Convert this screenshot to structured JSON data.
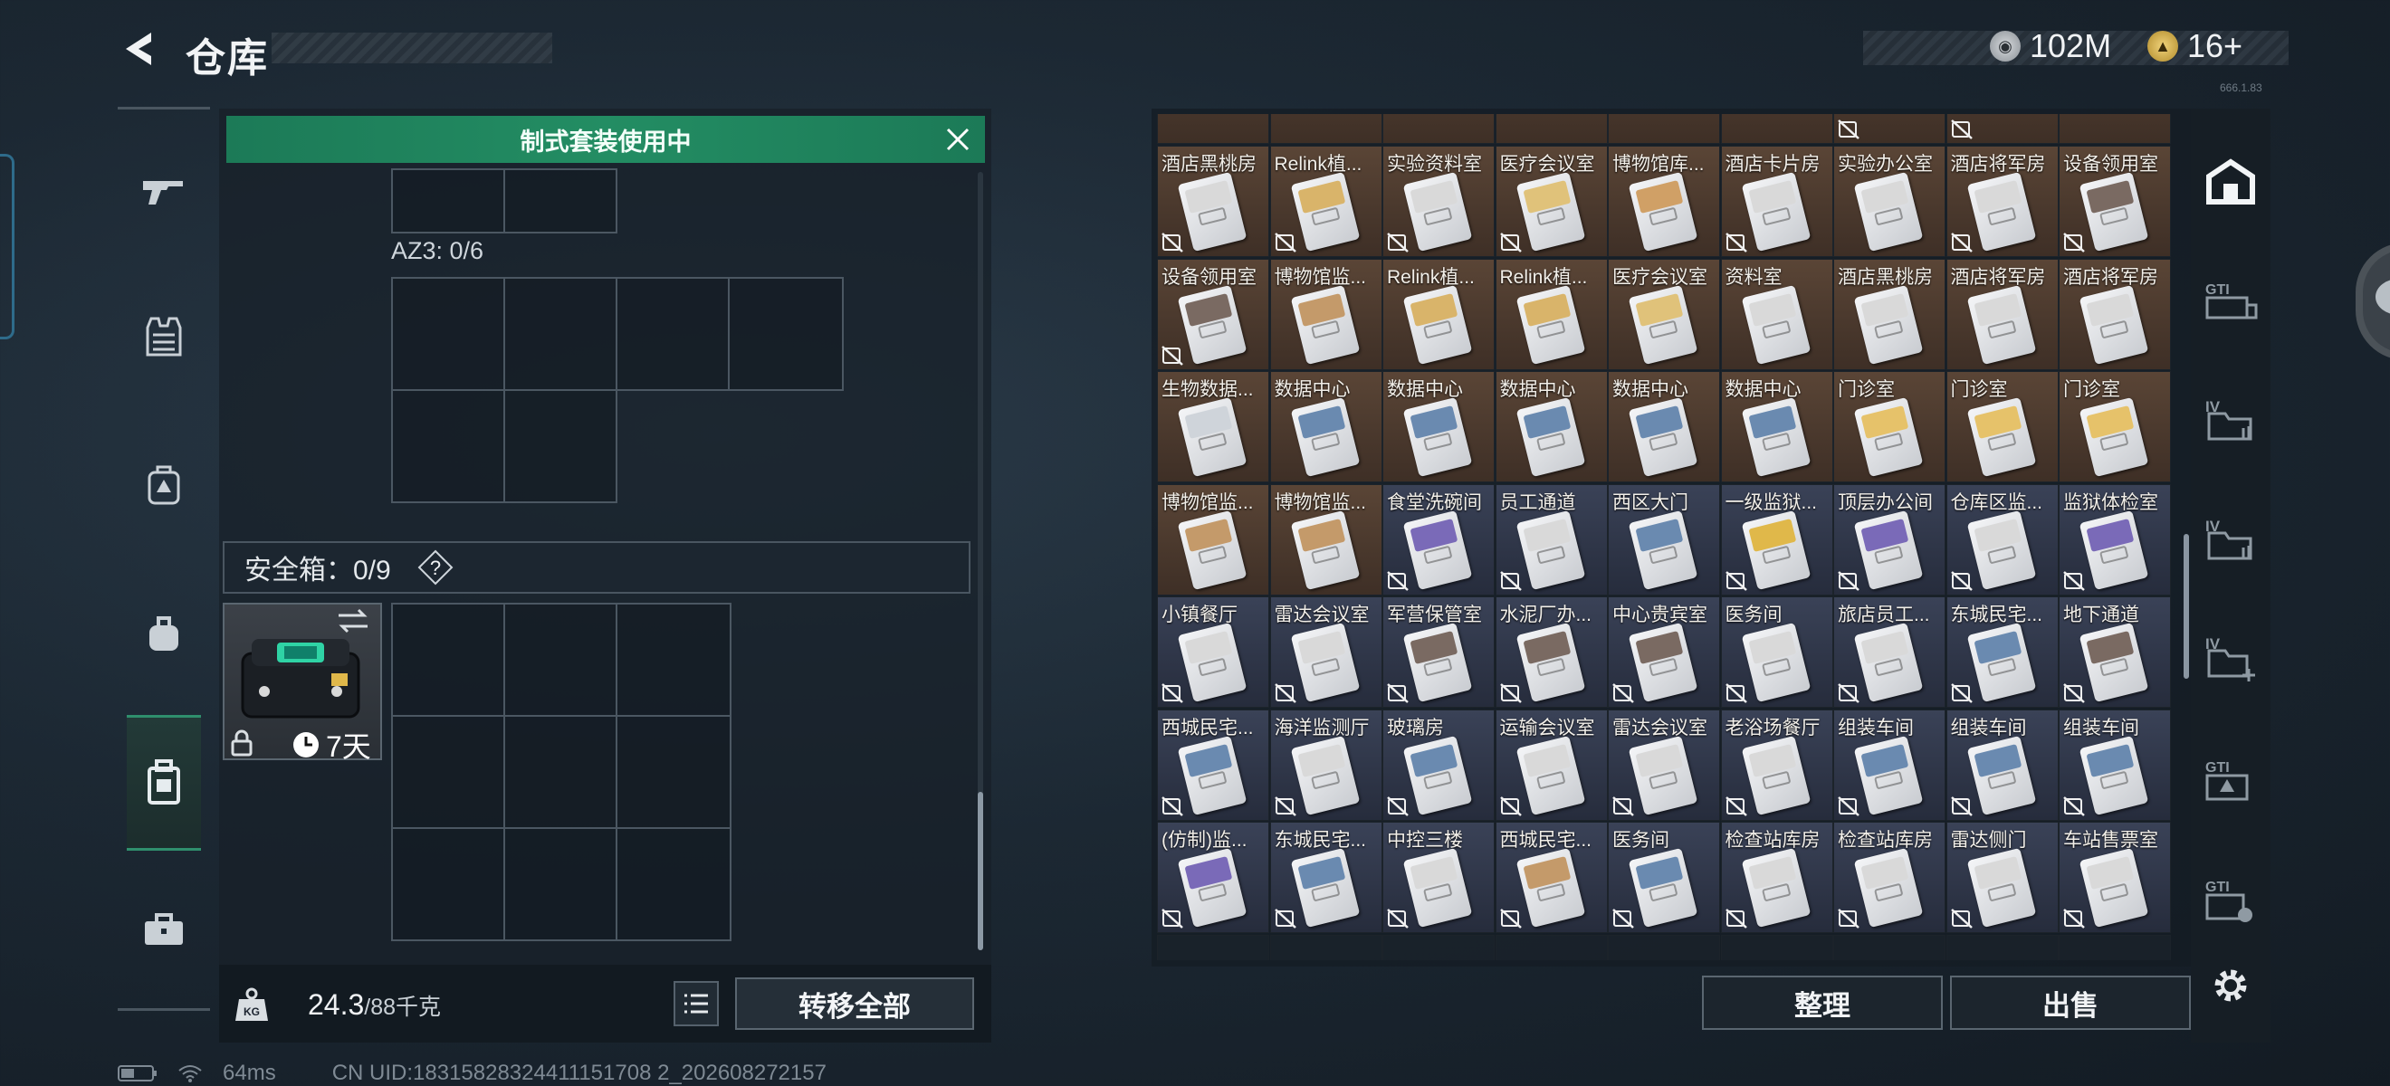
{
  "header": {
    "title": "仓库",
    "currency1": "102M",
    "currency2": "16+",
    "version": "666.1.83"
  },
  "banner": {
    "text": "制式套装使用中"
  },
  "vest": {
    "label": "AZ3: 0/6"
  },
  "safe": {
    "label": "安全箱：0/9",
    "days": "7天"
  },
  "footer": {
    "weight": "24.3",
    "capacity": "/88千克",
    "transfer": "转移全部"
  },
  "actions": {
    "sort": "整理",
    "sell": "出售"
  },
  "status": {
    "ping": "64ms",
    "uid": "CN UID:18315828324411151708 2_202608272157"
  },
  "grid": {
    "items": [
      {
        "name": "酒店黑桃房",
        "bg": "brown",
        "band": "#d9d9d9",
        "nosell": true
      },
      {
        "name": "Relink植...",
        "bg": "brown",
        "band": "#d9b46a",
        "nosell": true
      },
      {
        "name": "实验资料室",
        "bg": "brown",
        "band": "#d9d9d9",
        "nosell": true
      },
      {
        "name": "医疗会议室",
        "bg": "brown",
        "band": "#e0c27a",
        "nosell": true
      },
      {
        "name": "博物馆库...",
        "bg": "brown",
        "band": "#d0a066",
        "nosell": false
      },
      {
        "name": "酒店卡片房",
        "bg": "brown",
        "band": "#d9d9d9",
        "nosell": true
      },
      {
        "name": "实验办公室",
        "bg": "brown",
        "band": "#d9d9d9",
        "nosell": false
      },
      {
        "name": "酒店将军房",
        "bg": "brown",
        "band": "#d9d9d9",
        "nosell": true
      },
      {
        "name": "设备领用室",
        "bg": "brown",
        "band": "#7a6a62",
        "nosell": true
      },
      {
        "name": "设备领用室",
        "bg": "brown",
        "band": "#7a6a62",
        "nosell": true
      },
      {
        "name": "博物馆监...",
        "bg": "brown",
        "band": "#c49a6a",
        "nosell": false
      },
      {
        "name": "Relink植...",
        "bg": "brown",
        "band": "#d9b46a",
        "nosell": false
      },
      {
        "name": "Relink植...",
        "bg": "brown",
        "band": "#d9b46a",
        "nosell": false
      },
      {
        "name": "医疗会议室",
        "bg": "brown",
        "band": "#e0c27a",
        "nosell": false
      },
      {
        "name": "资料室",
        "bg": "brown",
        "band": "#d9d9d9",
        "nosell": false
      },
      {
        "name": "酒店黑桃房",
        "bg": "brown",
        "band": "#d9d9d9",
        "nosell": false
      },
      {
        "name": "酒店将军房",
        "bg": "brown",
        "band": "#d9d9d9",
        "nosell": false
      },
      {
        "name": "酒店将军房",
        "bg": "brown",
        "band": "#d9d9d9",
        "nosell": false
      },
      {
        "name": "生物数据...",
        "bg": "brown",
        "band": "#cfd4da",
        "nosell": false
      },
      {
        "name": "数据中心",
        "bg": "brown",
        "band": "#6a8ab0",
        "nosell": false
      },
      {
        "name": "数据中心",
        "bg": "brown",
        "band": "#6a8ab0",
        "nosell": false
      },
      {
        "name": "数据中心",
        "bg": "brown",
        "band": "#6a8ab0",
        "nosell": false
      },
      {
        "name": "数据中心",
        "bg": "brown",
        "band": "#6a8ab0",
        "nosell": false
      },
      {
        "name": "数据中心",
        "bg": "brown",
        "band": "#6a8ab0",
        "nosell": false
      },
      {
        "name": "门诊室",
        "bg": "brown",
        "band": "#e6c26a",
        "nosell": false
      },
      {
        "name": "门诊室",
        "bg": "brown",
        "band": "#e6c26a",
        "nosell": false
      },
      {
        "name": "门诊室",
        "bg": "brown",
        "band": "#e6c26a",
        "nosell": false
      },
      {
        "name": "博物馆监...",
        "bg": "brown",
        "band": "#c49a6a",
        "nosell": false
      },
      {
        "name": "博物馆监...",
        "bg": "brown",
        "band": "#c49a6a",
        "nosell": false
      },
      {
        "name": "食堂洗碗间",
        "bg": "navy",
        "band": "#7a6ab8",
        "nosell": true
      },
      {
        "name": "员工通道",
        "bg": "navy",
        "band": "#d9d9d9",
        "nosell": true
      },
      {
        "name": "西区大门",
        "bg": "navy",
        "band": "#6a8ab0",
        "nosell": false
      },
      {
        "name": "一级监狱...",
        "bg": "navy",
        "band": "#e0b84a",
        "nosell": true
      },
      {
        "name": "顶层办公间",
        "bg": "navy",
        "band": "#7a6ab8",
        "nosell": true
      },
      {
        "name": "仓库区监...",
        "bg": "navy",
        "band": "#d9d9d9",
        "nosell": true
      },
      {
        "name": "监狱体检室",
        "bg": "navy",
        "band": "#7a6ab8",
        "nosell": true
      },
      {
        "name": "小镇餐厅",
        "bg": "navy",
        "band": "#d9d9d9",
        "nosell": true
      },
      {
        "name": "雷达会议室",
        "bg": "navy",
        "band": "#d9d9d9",
        "nosell": true
      },
      {
        "name": "军营保管室",
        "bg": "navy",
        "band": "#7a6a62",
        "nosell": true
      },
      {
        "name": "水泥厂办...",
        "bg": "navy",
        "band": "#7a6a62",
        "nosell": true
      },
      {
        "name": "中心贵宾室",
        "bg": "navy",
        "band": "#7a6a62",
        "nosell": true
      },
      {
        "name": "医务间",
        "bg": "navy",
        "band": "#d9d9d9",
        "nosell": true
      },
      {
        "name": "旅店员工...",
        "bg": "navy",
        "band": "#d9d9d9",
        "nosell": true
      },
      {
        "name": "东城民宅...",
        "bg": "navy",
        "band": "#6a8ab0",
        "nosell": true
      },
      {
        "name": "地下通道",
        "bg": "navy",
        "band": "#7a6a62",
        "nosell": true
      },
      {
        "name": "西城民宅...",
        "bg": "navy",
        "band": "#6a8ab0",
        "nosell": true
      },
      {
        "name": "海洋监测厅",
        "bg": "navy",
        "band": "#d9d9d9",
        "nosell": true
      },
      {
        "name": "玻璃房",
        "bg": "navy",
        "band": "#6a8ab0",
        "nosell": true
      },
      {
        "name": "运输会议室",
        "bg": "navy",
        "band": "#d9d9d9",
        "nosell": true
      },
      {
        "name": "雷达会议室",
        "bg": "navy",
        "band": "#d9d9d9",
        "nosell": true
      },
      {
        "name": "老浴场餐厅",
        "bg": "navy",
        "band": "#d9d9d9",
        "nosell": true
      },
      {
        "name": "组装车间",
        "bg": "navy",
        "band": "#6a8ab0",
        "nosell": true
      },
      {
        "name": "组装车间",
        "bg": "navy",
        "band": "#6a8ab0",
        "nosell": true
      },
      {
        "name": "组装车间",
        "bg": "navy",
        "band": "#6a8ab0",
        "nosell": true
      },
      {
        "name": "(仿制)监...",
        "bg": "navy",
        "band": "#7a6ab8",
        "nosell": true
      },
      {
        "name": "东城民宅...",
        "bg": "navy",
        "band": "#6a8ab0",
        "nosell": true
      },
      {
        "name": "中控三楼",
        "bg": "navy",
        "band": "#d9d9d9",
        "nosell": true
      },
      {
        "name": "西城民宅...",
        "bg": "navy",
        "band": "#c49a6a",
        "nosell": true
      },
      {
        "name": "医务间",
        "bg": "navy",
        "band": "#6a8ab0",
        "nosell": true
      },
      {
        "name": "检查站库房",
        "bg": "navy",
        "band": "#d9d9d9",
        "nosell": true
      },
      {
        "name": "检查站库房",
        "bg": "navy",
        "band": "#d9d9d9",
        "nosell": true
      },
      {
        "name": "雷达侧门",
        "bg": "navy",
        "band": "#d9d9d9",
        "nosell": true
      },
      {
        "name": "车站售票室",
        "bg": "navy",
        "band": "#d9d9d9",
        "nosell": true
      }
    ]
  }
}
